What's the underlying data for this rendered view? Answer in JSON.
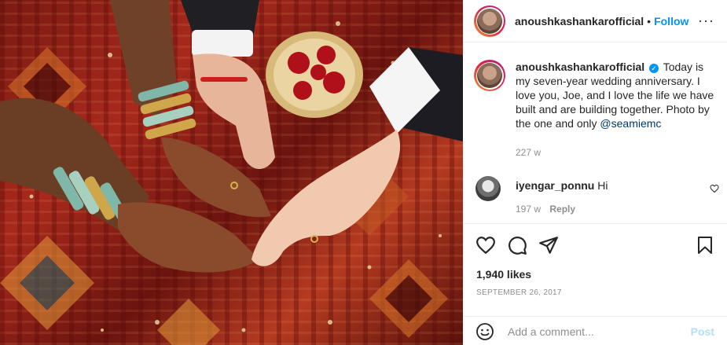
{
  "post": {
    "photo_alt": "Hands with henna, bangles and wedding rings on a red patterned cloth"
  },
  "header": {
    "username": "anoushkashankarofficial",
    "separator": "•",
    "follow_label": "Follow",
    "more_label": "···"
  },
  "caption": {
    "username": "anoushkashankarofficial",
    "verified_mark": "✓",
    "text": "Today is my seven-year wedding anniversary. I love you, Joe, and I love the life we have built and are building together. Photo by the one and only ",
    "mention": "@seamiemc",
    "timestamp": "227 w"
  },
  "comments": [
    {
      "username": "iyengar_ponnu",
      "text": "Hi",
      "timestamp": "197 w",
      "reply_label": "Reply"
    }
  ],
  "actions": {
    "icons": [
      "heart-icon",
      "comment-icon",
      "share-icon",
      "bookmark-icon"
    ]
  },
  "likes": {
    "text": "1,940 likes"
  },
  "date": {
    "text": "SEPTEMBER 26, 2017"
  },
  "add_comment": {
    "placeholder": "Add a comment...",
    "post_label": "Post"
  },
  "colors": {
    "accent": "#0095f6",
    "mention": "#00376b",
    "secondary_text": "#8e8e8e",
    "post_disabled": "#b2dffc"
  }
}
